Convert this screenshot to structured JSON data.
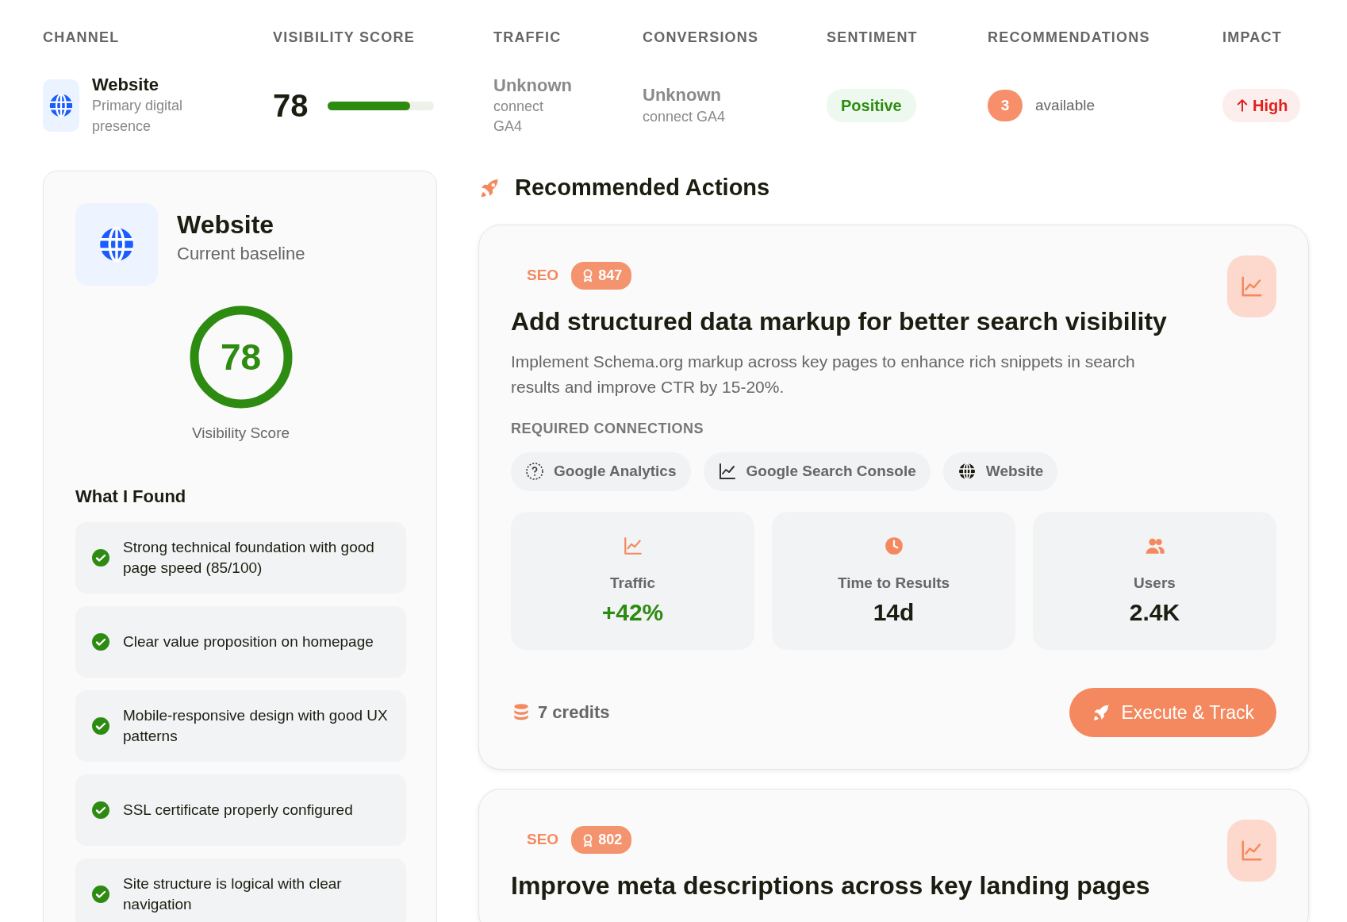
{
  "table": {
    "columns": [
      "CHANNEL",
      "VISIBILITY SCORE",
      "TRAFFIC",
      "CONVERSIONS",
      "SENTIMENT",
      "RECOMMENDATIONS",
      "IMPACT"
    ],
    "row": {
      "channel": {
        "name": "Website",
        "subtitle": "Primary digital presence"
      },
      "visibility": {
        "score": "78",
        "level": 0.78
      },
      "traffic": {
        "value": "Unknown",
        "hint": "connect GA4"
      },
      "conversions": {
        "value": "Unknown",
        "hint": "connect GA4"
      },
      "sentiment": "Positive",
      "recommendations": {
        "count": "3",
        "label": "available"
      },
      "impact": "High"
    }
  },
  "baseline": {
    "title": "Website",
    "subtitle": "Current baseline",
    "score": "78",
    "score_label": "Visibility Score",
    "findings_title": "What I Found",
    "findings": [
      "Strong technical foundation with good page speed (85/100)",
      "Clear value proposition on homepage",
      "Mobile-responsive design with good UX patterns",
      "SSL certificate properly configured",
      "Site structure is logical with clear navigation"
    ]
  },
  "actions": {
    "title": "Recommended Actions",
    "items": [
      {
        "category": "SEO",
        "points": "847",
        "title": "Add structured data markup for better search visibility",
        "description": "Implement Schema.org markup across key pages to enhance rich snippets in search results and improve CTR by 15-20%.",
        "connections_label": "REQUIRED CONNECTIONS",
        "connections": [
          {
            "label": "Google Analytics",
            "kind": "help"
          },
          {
            "label": "Google Search Console",
            "kind": "chart"
          },
          {
            "label": "Website",
            "kind": "globe"
          }
        ],
        "metrics": [
          {
            "label": "Traffic",
            "value": "+42%",
            "kind": "chart",
            "positive": true
          },
          {
            "label": "Time to Results",
            "value": "14d",
            "kind": "clock",
            "positive": false
          },
          {
            "label": "Users",
            "value": "2.4K",
            "kind": "users",
            "positive": false
          }
        ],
        "credits": "7 credits",
        "button": "Execute & Track"
      },
      {
        "category": "SEO",
        "points": "802",
        "title": "Improve meta descriptions across key landing pages"
      }
    ]
  }
}
